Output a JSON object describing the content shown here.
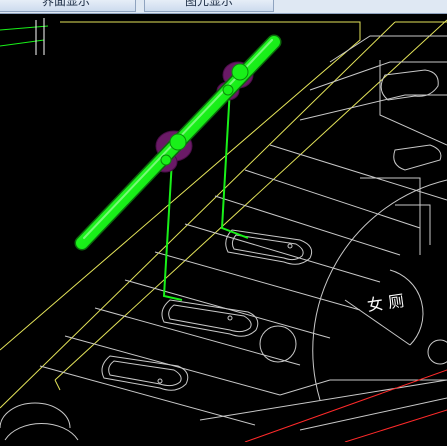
{
  "toolbar": {
    "tabs": [
      {
        "label": "界面显示"
      },
      {
        "label": "图元显示"
      }
    ]
  },
  "drawing": {
    "room_label": "女 厕"
  },
  "colors": {
    "background": "#000000",
    "pipe": "#19f019",
    "fitting": "#6a1a66",
    "linework": "#c8c8c8",
    "boundary": "#e4e45a",
    "axis": "#ff2a2a",
    "room_text": "#ffffff"
  }
}
